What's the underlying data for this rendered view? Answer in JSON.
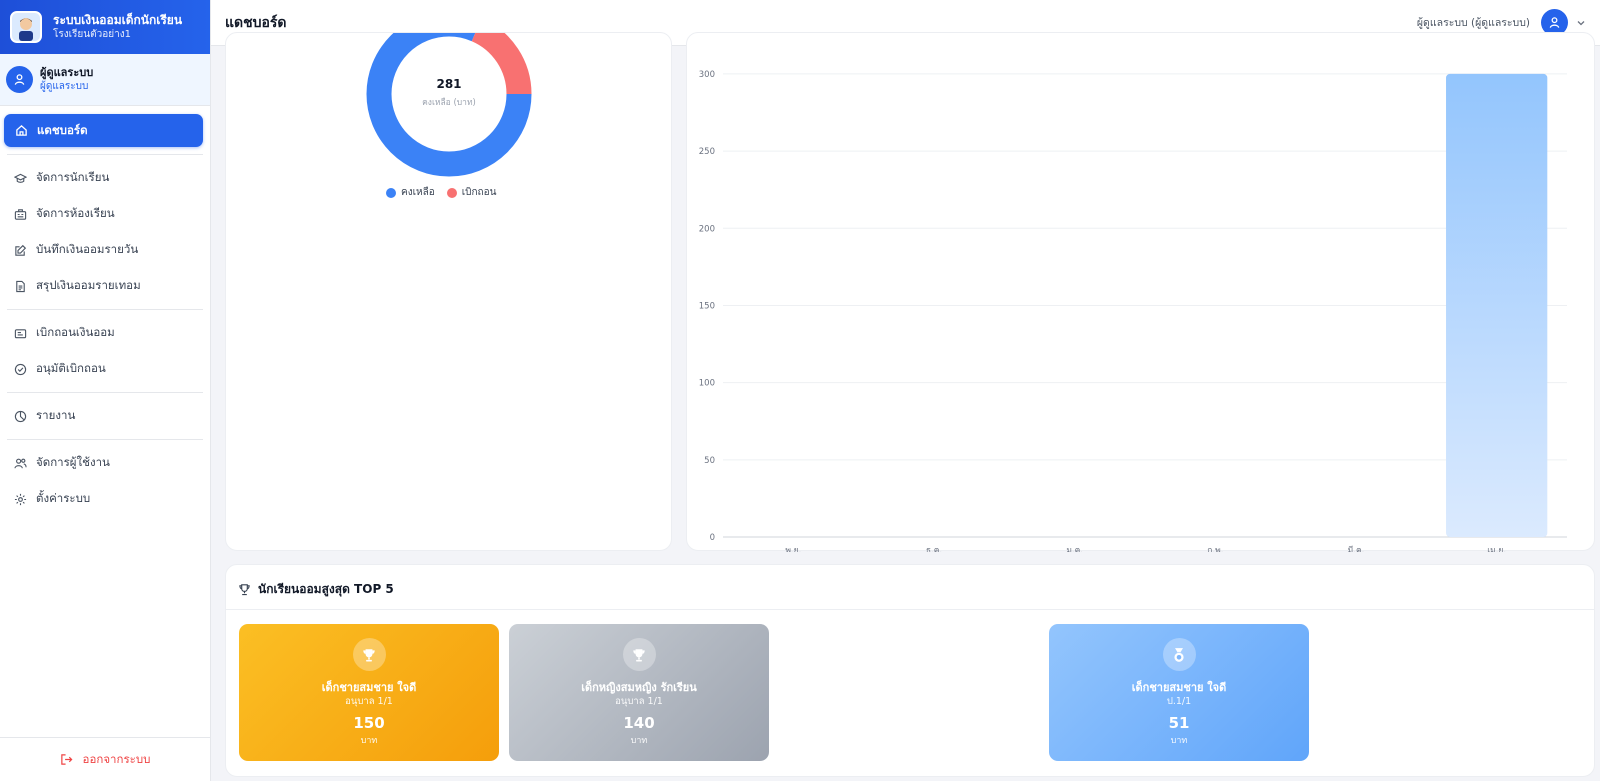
{
  "app": {
    "title": "ระบบเงินออมเด็กนักเรียน",
    "school": "โรงเรียนตัวอย่าง1"
  },
  "user": {
    "name": "ผู้ดูแลระบบ",
    "role": "ผู้ดูแลระบบ",
    "header_label": "ผู้ดูแลระบบ (ผู้ดูแลระบบ)"
  },
  "header": {
    "title": "แดชบอร์ด"
  },
  "sidebar": {
    "active": "แดชบอร์ด",
    "group1": [
      "จัดการนักเรียน",
      "จัดการห้องเรียน",
      "บันทึกเงินออมรายวัน",
      "สรุปเงินออมรายเทอม"
    ],
    "group2": [
      "เบิกถอนเงินออม",
      "อนุมัติเบิกถอน"
    ],
    "group3": [
      "รายงาน"
    ],
    "group4": [
      "จัดการผู้ใช้งาน",
      "ตั้งค่าระบบ"
    ],
    "logout": "ออกจากระบบ"
  },
  "donut": {
    "center_value": "281",
    "center_label": "คงเหลือ (บาท)",
    "legend": [
      "คงเหลือ",
      "เบิกถอน"
    ]
  },
  "chart_data": [
    {
      "type": "pie",
      "variant": "donut",
      "categories": [
        "คงเหลือ",
        "เบิกถอน"
      ],
      "values": [
        281,
        64
      ],
      "colors": [
        "#3b82f6",
        "#f87171"
      ],
      "legend_position": "bottom"
    },
    {
      "type": "bar",
      "categories": [
        "พ.ย.",
        "ธ.ค.",
        "ม.ค.",
        "ก.พ.",
        "มี.ค.",
        "เม.ย."
      ],
      "values": [
        0,
        0,
        0,
        0,
        0,
        300
      ],
      "ylim": [
        0,
        320
      ],
      "yticks": [
        0,
        50,
        100,
        150,
        200,
        250,
        300
      ],
      "grid": true,
      "color": "#93c5fd"
    }
  ],
  "top5": {
    "title": "นักเรียนออมสูงสุด TOP 5",
    "unit": "บาท",
    "items": [
      {
        "name": "เด็กชายสมชาย ใจดี",
        "class": "อนุบาล 1/1",
        "amount": "150",
        "color_from": "#fbbf24",
        "color_to": "#f59e0b",
        "icon": "trophy-icon"
      },
      {
        "name": "เด็กหญิงสมหญิง รักเรียน",
        "class": "อนุบาล 1/1",
        "amount": "140",
        "color_from": "#cbd0d6",
        "color_to": "#9ca3af",
        "icon": "trophy-icon"
      },
      {
        "name": "เด็กชายสมชาย ใจดี",
        "class": "ป.1/1",
        "amount": "51",
        "color_from": "#93c5fd",
        "color_to": "#60a5fa",
        "icon": "medal-icon"
      }
    ]
  }
}
